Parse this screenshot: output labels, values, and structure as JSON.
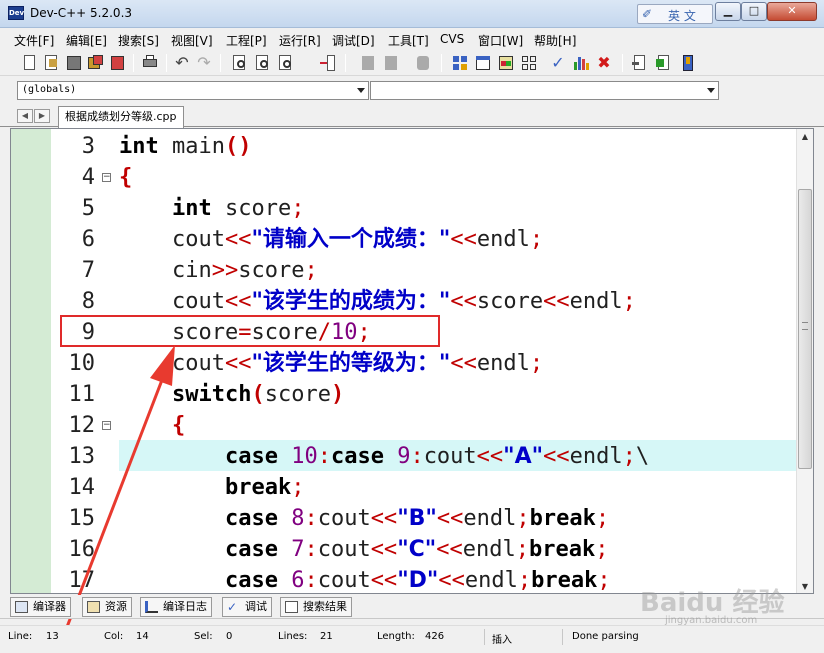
{
  "window": {
    "title": "Dev-C++ 5.2.0.3",
    "app_icon_text": "Dev",
    "ime_label": "英 文",
    "min_icon": "minimize-icon",
    "max_icon": "maximize-icon",
    "close_icon": "close-icon"
  },
  "menu": [
    "文件[F]",
    "编辑[E]",
    "搜索[S]",
    "视图[V]",
    "工程[P]",
    "运行[R]",
    "调试[D]",
    "工具[T]",
    "CVS",
    "窗口[W]",
    "帮助[H]"
  ],
  "combos": {
    "scope": "(globals)",
    "function": ""
  },
  "tab": {
    "filename": "根据成绩划分等级.cpp"
  },
  "code_lines": [
    {
      "no": "3",
      "html": "<span class=\"kw\">int</span> <span class=\"id\">main</span><span class=\"pa\">()</span>",
      "fold": false
    },
    {
      "no": "4",
      "html": "<span class=\"pa\">{</span>",
      "fold": true
    },
    {
      "no": "5",
      "html": "    <span class=\"kw\">int</span> <span class=\"id\">score</span><span class=\"op\">;</span>",
      "fold": false
    },
    {
      "no": "6",
      "html": "    <span class=\"id\">cout</span><span class=\"op\">&lt;&lt;</span><span class=\"str\">\"请输入一个成绩：\"</span><span class=\"op\">&lt;&lt;</span><span class=\"id\">endl</span><span class=\"op\">;</span>",
      "fold": false
    },
    {
      "no": "7",
      "html": "    <span class=\"id\">cin</span><span class=\"op\">&gt;&gt;</span><span class=\"id\">score</span><span class=\"op\">;</span>",
      "fold": false
    },
    {
      "no": "8",
      "html": "    <span class=\"id\">cout</span><span class=\"op\">&lt;&lt;</span><span class=\"str\">\"该学生的成绩为：\"</span><span class=\"op\">&lt;&lt;</span><span class=\"id\">score</span><span class=\"op\">&lt;&lt;</span><span class=\"id\">endl</span><span class=\"op\">;</span>",
      "fold": false
    },
    {
      "no": "9",
      "html": "    <span class=\"id\">score</span><span class=\"op\">=</span><span class=\"id\">score</span><span class=\"op\">/</span><span class=\"num\">10</span><span class=\"op\">;</span>",
      "fold": false
    },
    {
      "no": "10",
      "html": "    <span class=\"id\">cout</span><span class=\"op\">&lt;&lt;</span><span class=\"str\">\"该学生的等级为：\"</span><span class=\"op\">&lt;&lt;</span><span class=\"id\">endl</span><span class=\"op\">;</span>",
      "fold": false
    },
    {
      "no": "11",
      "html": "    <span class=\"kw\">switch</span><span class=\"pa\">(</span><span class=\"id\">score</span><span class=\"pa\">)</span>",
      "fold": false
    },
    {
      "no": "12",
      "html": "    <span class=\"pa\">{</span>",
      "fold": true
    },
    {
      "no": "13",
      "html": "        <span class=\"kw\">case</span> <span class=\"num\">10</span><span class=\"op\">:</span><span class=\"kw\">case</span> <span class=\"num\">9</span><span class=\"op\">:</span><span class=\"id\">cout</span><span class=\"op\">&lt;&lt;</span><span class=\"str\">\"A\"</span><span class=\"op\">&lt;&lt;</span><span class=\"id\">endl</span><span class=\"op\">;</span><span class=\"id\">\\</span>",
      "fold": false
    },
    {
      "no": "14",
      "html": "        <span class=\"kw\">break</span><span class=\"op\">;</span>",
      "fold": false
    },
    {
      "no": "15",
      "html": "        <span class=\"kw\">case</span> <span class=\"num\">8</span><span class=\"op\">:</span><span class=\"id\">cout</span><span class=\"op\">&lt;&lt;</span><span class=\"str\">\"B\"</span><span class=\"op\">&lt;&lt;</span><span class=\"id\">endl</span><span class=\"op\">;</span><span class=\"kw\">break</span><span class=\"op\">;</span>",
      "fold": false
    },
    {
      "no": "16",
      "html": "        <span class=\"kw\">case</span> <span class=\"num\">7</span><span class=\"op\">:</span><span class=\"id\">cout</span><span class=\"op\">&lt;&lt;</span><span class=\"str\">\"C\"</span><span class=\"op\">&lt;&lt;</span><span class=\"id\">endl</span><span class=\"op\">;</span><span class=\"kw\">break</span><span class=\"op\">;</span>",
      "fold": false
    },
    {
      "no": "17",
      "html": "        <span class=\"kw\">case</span> <span class=\"num\">6</span><span class=\"op\">:</span><span class=\"id\">cout</span><span class=\"op\">&lt;&lt;</span><span class=\"str\">\"D\"</span><span class=\"op\">&lt;&lt;</span><span class=\"id\">endl</span><span class=\"op\">;</span><span class=\"kw\">break</span><span class=\"op\">;</span>",
      "fold": false
    }
  ],
  "highlighted_line": "13",
  "annotation_color": "#e02a2a",
  "bottom_tabs": [
    "编译器",
    "资源",
    "编译日志",
    "调试",
    "搜索结果"
  ],
  "status": {
    "line_label": "Line:",
    "line_value": "13",
    "col_label": "Col:",
    "col_value": "14",
    "sel_label": "Sel:",
    "sel_value": "0",
    "lines_label": "Lines:",
    "lines_value": "21",
    "length_label": "Length:",
    "length_value": "426",
    "mode": "插入",
    "message": "Done parsing"
  },
  "watermark": {
    "text": "Baidu 经验",
    "sub": "jingyan.baidu.com"
  }
}
